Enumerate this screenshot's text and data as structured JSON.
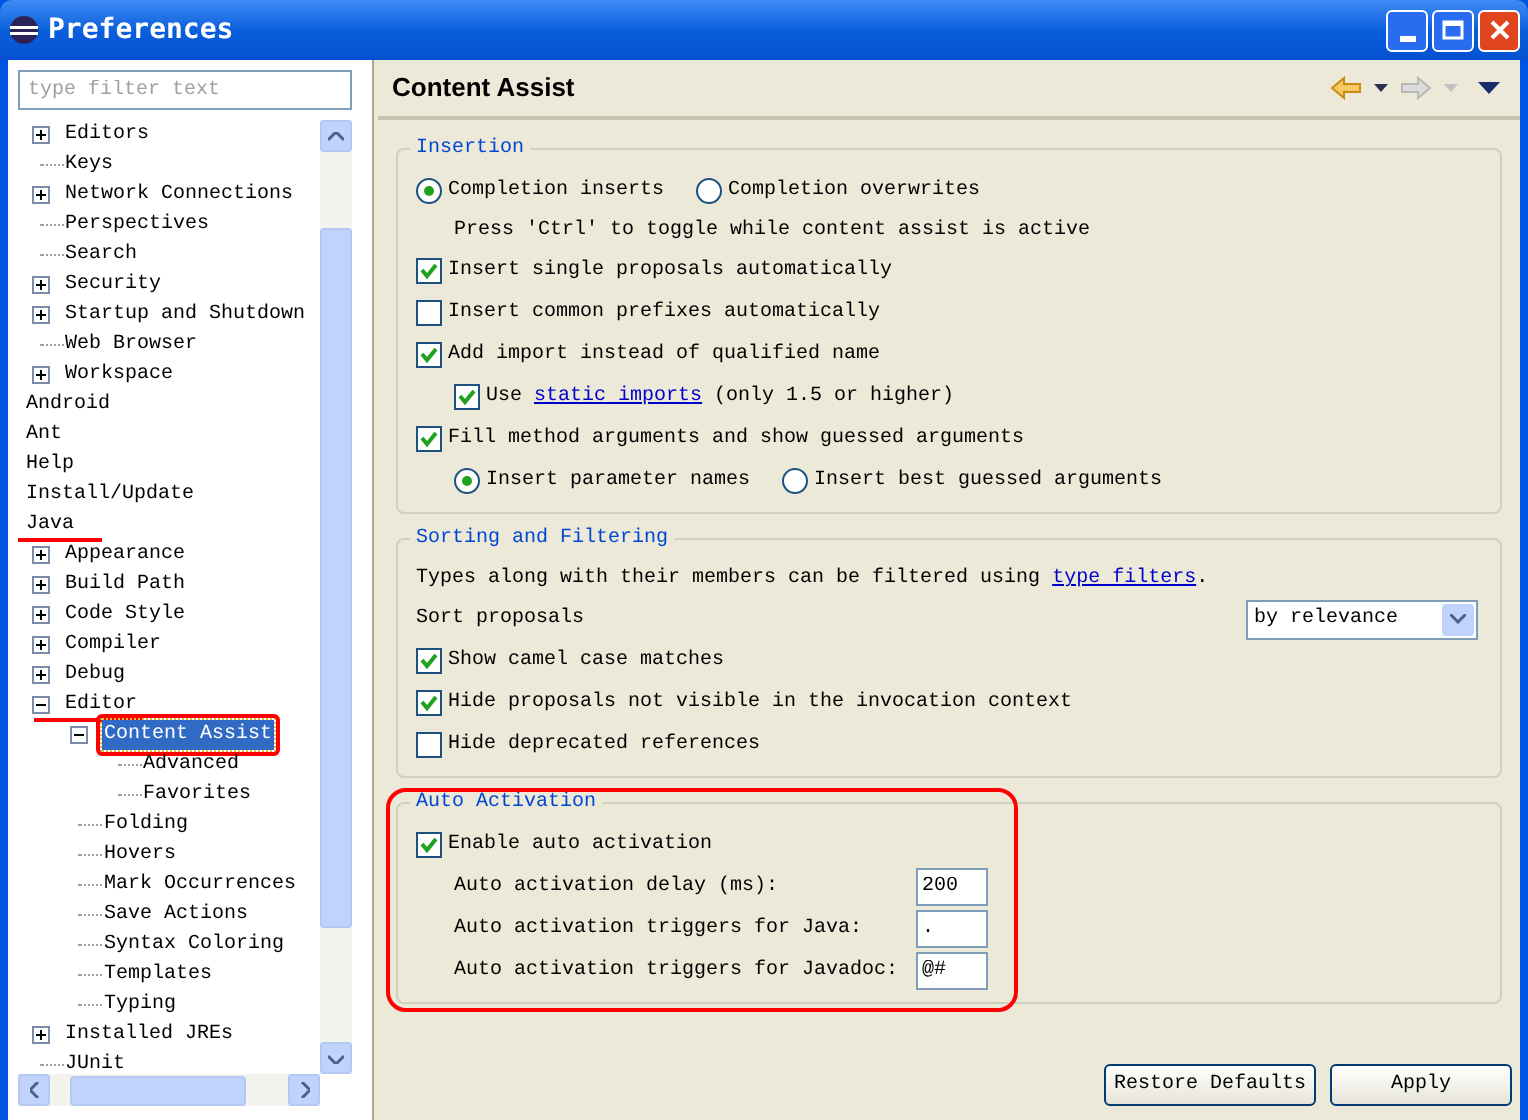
{
  "window": {
    "title": "Preferences"
  },
  "filter": {
    "placeholder": "type filter text"
  },
  "tree": [
    {
      "children": [
        {
          "label": "Editors",
          "expanded": false,
          "selected": false
        },
        {
          "label": "Keys",
          "selected": false
        },
        {
          "label": "Network Connections",
          "expanded": false,
          "selected": false
        },
        {
          "label": "Perspectives",
          "selected": false
        },
        {
          "label": "Search",
          "selected": false
        },
        {
          "label": "Security",
          "expanded": false,
          "selected": false
        },
        {
          "label": "Startup and Shutdown",
          "expanded": false,
          "selected": false
        },
        {
          "label": "Web Browser",
          "selected": false
        },
        {
          "label": "Workspace",
          "expanded": false,
          "selected": false
        }
      ]
    },
    {
      "label": "Android",
      "selected": false,
      "underlined": false
    },
    {
      "label": "Ant",
      "selected": false,
      "underlined": false
    },
    {
      "label": "Help",
      "selected": false,
      "underlined": false
    },
    {
      "label": "Install/Update",
      "selected": false,
      "underlined": false
    },
    {
      "label": "Java",
      "selected": false,
      "underlined": true,
      "children": [
        {
          "label": "Appearance",
          "expanded": false,
          "selected": false,
          "underlined": false
        },
        {
          "label": "Build Path",
          "expanded": false,
          "selected": false,
          "underlined": false
        },
        {
          "label": "Code Style",
          "expanded": false,
          "selected": false,
          "underlined": false
        },
        {
          "label": "Compiler",
          "expanded": false,
          "selected": false,
          "underlined": false
        },
        {
          "label": "Debug",
          "expanded": false,
          "selected": false,
          "underlined": false
        },
        {
          "label": "Editor",
          "expanded": true,
          "selected": false,
          "underlined": true,
          "children": [
            {
              "label": "Content Assist",
              "expanded": true,
              "selected": true,
              "boxed": true,
              "children": [
                {
                  "label": "Advanced",
                  "selected": false
                },
                {
                  "label": "Favorites",
                  "selected": false
                }
              ]
            },
            {
              "label": "Folding",
              "selected": false,
              "boxed": false
            },
            {
              "label": "Hovers",
              "selected": false,
              "boxed": false
            },
            {
              "label": "Mark Occurrences",
              "selected": false,
              "boxed": false
            },
            {
              "label": "Save Actions",
              "selected": false,
              "boxed": false
            },
            {
              "label": "Syntax Coloring",
              "selected": false,
              "boxed": false
            },
            {
              "label": "Templates",
              "selected": false,
              "boxed": false
            },
            {
              "label": "Typing",
              "selected": false,
              "boxed": false
            }
          ]
        },
        {
          "label": "Installed JREs",
          "expanded": false,
          "selected": false,
          "underlined": false
        },
        {
          "label": "JUnit",
          "selected": false,
          "underlined": false
        }
      ]
    }
  ],
  "page": {
    "title": "Content Assist",
    "nav": [
      {
        "kind": "back",
        "disabled": false
      },
      {
        "kind": "forward",
        "disabled": true
      }
    ]
  },
  "groups": [
    {
      "title": "Insertion",
      "annotated": false,
      "rows": [
        {
          "kind": "radios",
          "options": [
            {
              "label": "Completion inserts",
              "selected": true
            },
            {
              "label": "Completion overwrites",
              "selected": false
            }
          ]
        },
        {
          "kind": "note",
          "text": "Press 'Ctrl' to toggle while content assist is active"
        },
        {
          "kind": "checkbox",
          "label": "Insert single proposals automatically",
          "checked": true
        },
        {
          "kind": "checkbox",
          "label": "Insert common prefixes automatically",
          "checked": false
        },
        {
          "kind": "checkbox",
          "label": "Add import instead of qualified name",
          "checked": true,
          "children": [
            {
              "kind": "checkbox",
              "label": "Use ",
              "link": "static imports",
              "label_after": " (only 1.5 or higher)",
              "checked": true
            }
          ]
        },
        {
          "kind": "checkbox",
          "label": "Fill method arguments and show guessed arguments",
          "checked": true,
          "children": [
            {
              "kind": "radios",
              "options": [
                {
                  "label": "Insert parameter names",
                  "selected": true
                },
                {
                  "label": "Insert best guessed arguments",
                  "selected": false
                }
              ]
            }
          ]
        }
      ]
    },
    {
      "title": "Sorting and Filtering",
      "annotated": false,
      "rows": [
        {
          "kind": "text",
          "text": "Types along with their members can be filtered using ",
          "link": "type filters",
          "text_after": "."
        },
        {
          "kind": "select",
          "label": "Sort proposals",
          "value": "by relevance"
        },
        {
          "kind": "checkbox",
          "label": "Show camel case matches",
          "checked": true
        },
        {
          "kind": "checkbox",
          "label": "Hide proposals not visible in the invocation context",
          "checked": true
        },
        {
          "kind": "checkbox",
          "label": "Hide deprecated references",
          "checked": false
        }
      ]
    },
    {
      "title": "Auto Activation",
      "annotated": true,
      "rows": [
        {
          "kind": "checkbox",
          "label": "Enable auto activation",
          "checked": true,
          "children": [
            {
              "kind": "field",
              "label": "Auto activation delay (ms):",
              "value": "200"
            },
            {
              "kind": "field",
              "label": "Auto activation triggers for Java:",
              "value": "."
            },
            {
              "kind": "field",
              "label": "Auto activation triggers for Javadoc:",
              "value": "@#"
            }
          ]
        }
      ]
    }
  ],
  "buttons": [
    "Restore Defaults",
    "Apply"
  ]
}
